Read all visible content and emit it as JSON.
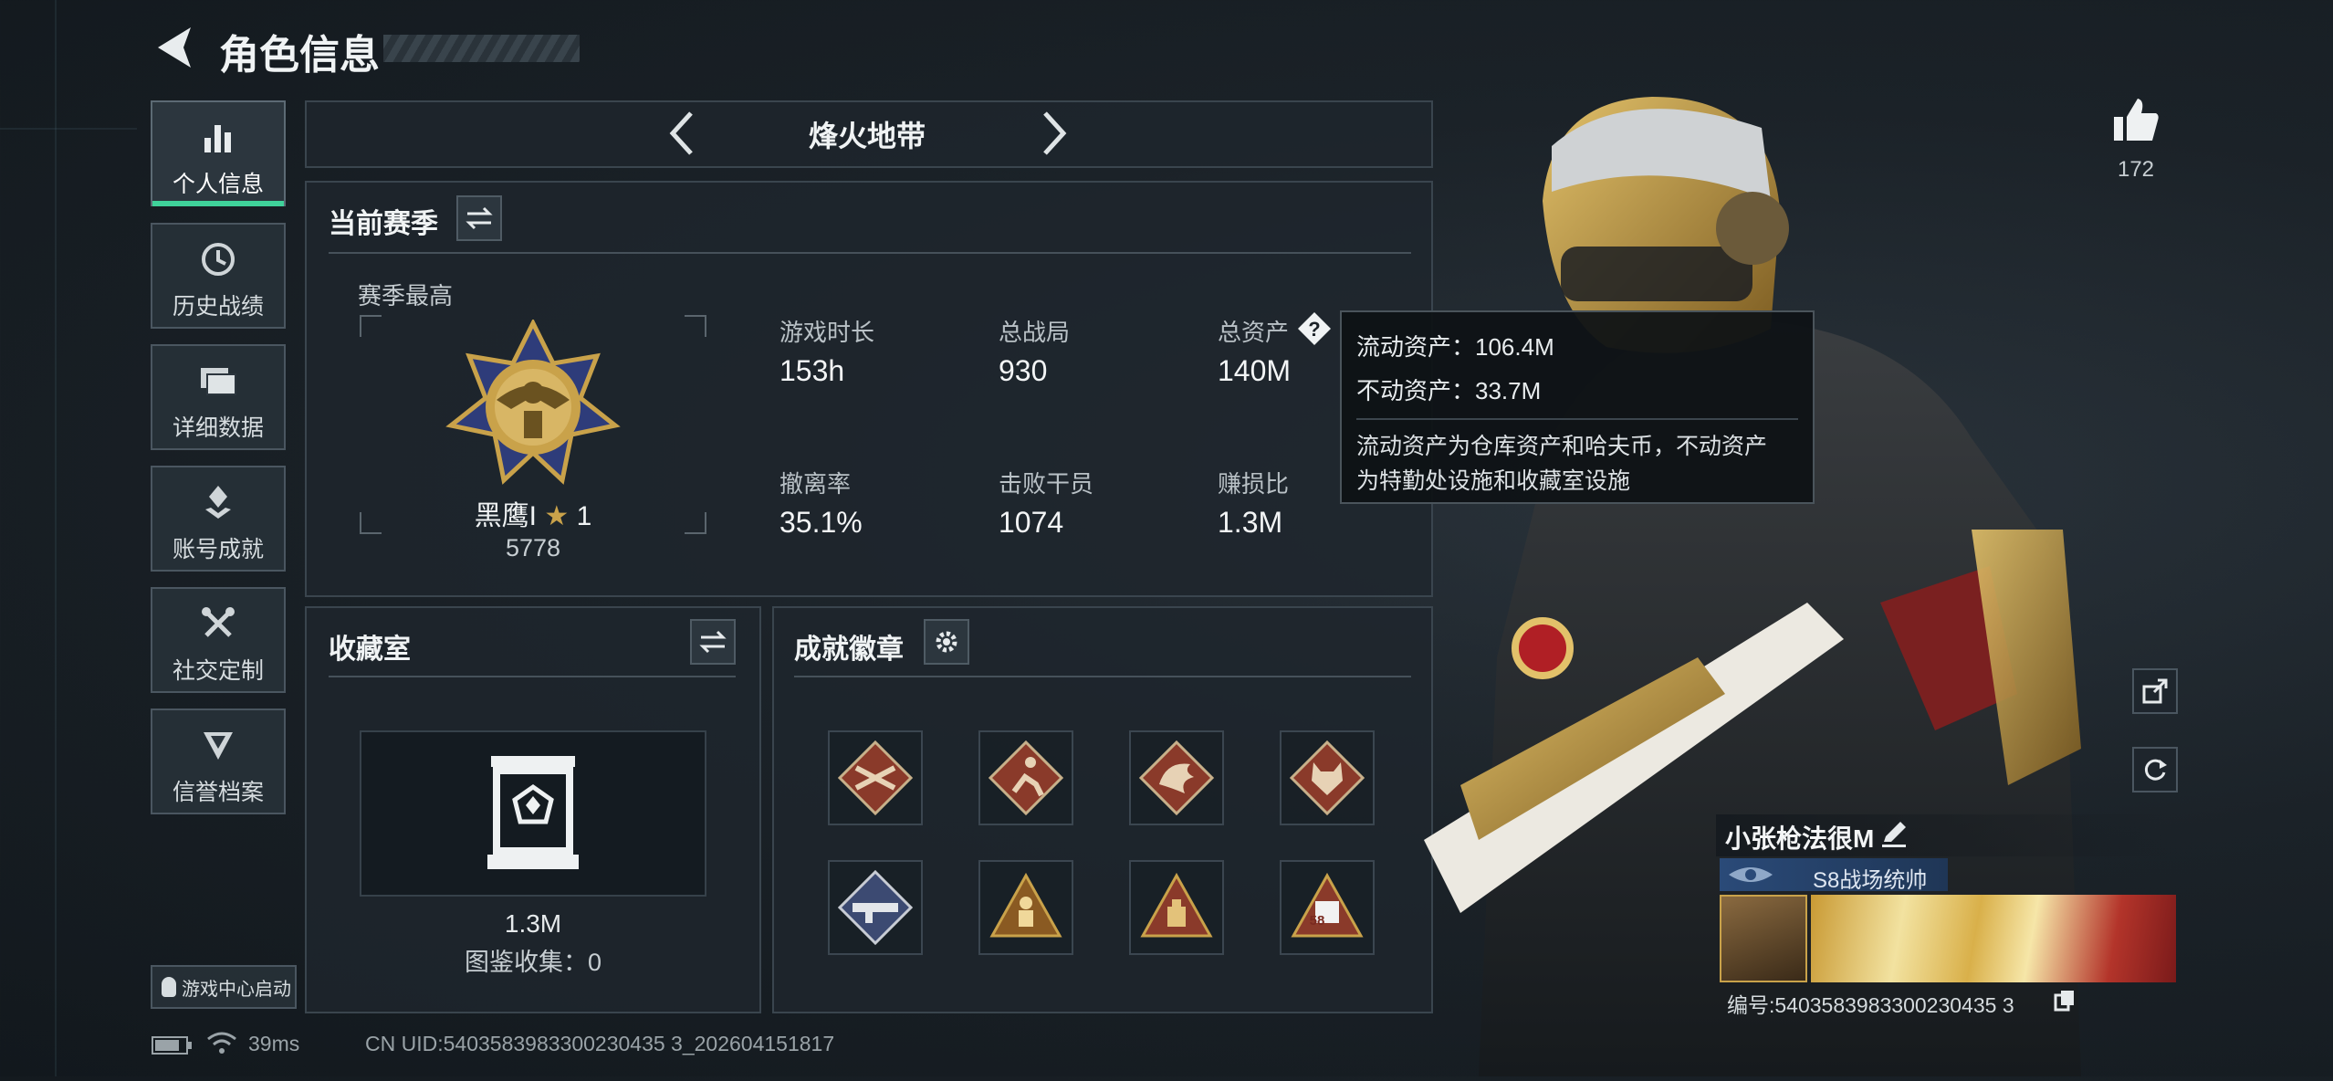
{
  "header": {
    "title": "角色信息"
  },
  "sidebar": {
    "items": [
      {
        "label": "个人信息",
        "icon": "bar-chart-icon"
      },
      {
        "label": "历史战绩",
        "icon": "clock-icon"
      },
      {
        "label": "详细数据",
        "icon": "folder-icon"
      },
      {
        "label": "账号成就",
        "icon": "trophy-icon"
      },
      {
        "label": "社交定制",
        "icon": "tools-icon"
      },
      {
        "label": "信誉档案",
        "icon": "shield-icon"
      }
    ],
    "launch_label": "游戏中心启动"
  },
  "mode_selector": {
    "label": "烽火地带"
  },
  "season": {
    "title": "当前赛季",
    "subtitle": "赛季最高",
    "rank_name": "黑鹰I",
    "rank_stars": "1",
    "rank_score": "5778",
    "stats": [
      {
        "label": "游戏时长",
        "value": "153h"
      },
      {
        "label": "总战局",
        "value": "930"
      },
      {
        "label": "总资产",
        "value": "140M"
      },
      {
        "label": "撤离率",
        "value": "35.1%"
      },
      {
        "label": "击败干员",
        "value": "1074"
      },
      {
        "label": "赚损比",
        "value": "1.3M"
      }
    ]
  },
  "tooltip": {
    "liquid": "流动资产：106.4M",
    "fixed": "不动资产：33.7M",
    "desc_line1": "流动资产为仓库资产和哈夫币，不动资产",
    "desc_line2": "为特勤处设施和收藏室设施"
  },
  "collection": {
    "title": "收藏室",
    "value": "1.3M",
    "caption": "图鉴收集：0"
  },
  "achievements": {
    "title": "成就徽章",
    "badges": [
      "crossed-guns-icon",
      "runner-icon",
      "dragon-icon",
      "wolf-icon",
      "rocket-launcher-icon",
      "figure-icon",
      "bag-icon",
      "number-badge-icon"
    ],
    "badge_58_text": "58"
  },
  "profile": {
    "likes": "172",
    "name": "小张枪法很M",
    "season_title": "S8战场统帅",
    "id_text": "编号:5403583983300230435 3"
  },
  "status_bar": {
    "ping": "39ms",
    "uid": "CN UID:5403583983300230435 3_202604151817"
  },
  "colors": {
    "accent_green": "#3fd29a",
    "panel_bg": "#1e262d",
    "badge_red": "#8a3a2a",
    "badge_gold": "#c9a24a",
    "title_bar_blue": "#2a4a78"
  }
}
